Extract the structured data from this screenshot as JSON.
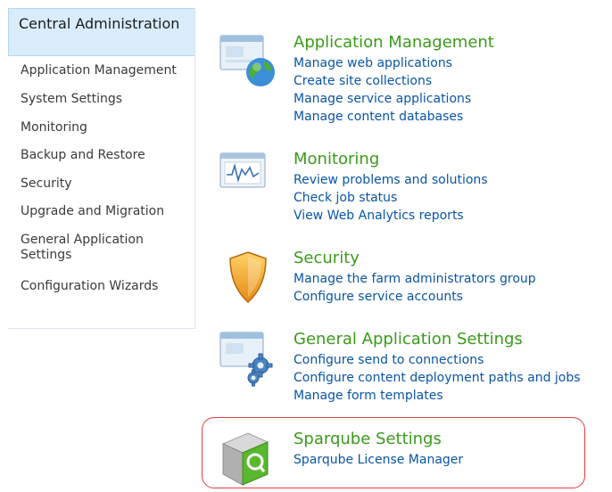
{
  "nav": {
    "header": "Central Administration",
    "items": [
      "Application Management",
      "System Settings",
      "Monitoring",
      "Backup and Restore",
      "Security",
      "Upgrade and Migration",
      "General Application Settings",
      "Configuration Wizards"
    ]
  },
  "sections": [
    {
      "title": "Application Management",
      "icon": "application-management-icon",
      "links": [
        "Manage web applications",
        "Create site collections",
        "Manage service applications",
        "Manage content databases"
      ]
    },
    {
      "title": "Monitoring",
      "icon": "monitoring-icon",
      "links": [
        "Review problems and solutions",
        "Check job status",
        "View Web Analytics reports"
      ]
    },
    {
      "title": "Security",
      "icon": "security-shield-icon",
      "links": [
        "Manage the farm administrators group",
        "Configure service accounts"
      ]
    },
    {
      "title": "General Application Settings",
      "icon": "general-settings-icon",
      "links": [
        "Configure send to connections",
        "Configure content deployment paths and jobs",
        "Manage form templates"
      ]
    },
    {
      "title": "Sparqube Settings",
      "icon": "sparqube-icon",
      "links": [
        "Sparqube License Manager"
      ]
    }
  ],
  "colors": {
    "title_green": "#3a9b1a",
    "link_blue": "#0a55a5",
    "highlight_red": "#e33d3d",
    "nav_header_bg": "#d9ecfb"
  }
}
